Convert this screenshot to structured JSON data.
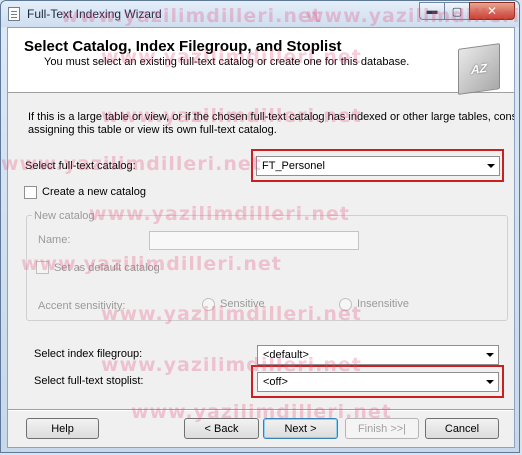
{
  "window": {
    "title": "Full-Text Indexing Wizard",
    "min": "▬",
    "max": "▢",
    "close": "✕"
  },
  "header": {
    "title": "Select Catalog, Index Filegroup, and Stoplist",
    "subtitle": "You must select an existing full-text catalog or create one for this database.",
    "icon_text": "AZ"
  },
  "description": {
    "line1": "If this is a large table or view, or if the chosen full-text catalog has indexed or other large tables, consider",
    "line2": "assigning this table or view its own full-text catalog."
  },
  "catalog": {
    "label": "Select full-text catalog:",
    "value": "FT_Personel"
  },
  "create_new": {
    "label": "Create a new catalog",
    "checked": false
  },
  "new_catalog": {
    "group_label": "New catalog",
    "name_label": "Name:",
    "name_value": "",
    "default_label": "Set as default catalog",
    "accent_label": "Accent sensitivity:",
    "sensitive_label": "Sensitive",
    "insensitive_label": "Insensitive"
  },
  "filegroup": {
    "label": "Select index filegroup:",
    "value": "<default>"
  },
  "stoplist": {
    "label": "Select full-text stoplist:",
    "value": "<off>"
  },
  "buttons": {
    "help": "Help",
    "back": "< Back",
    "next": "Next >",
    "finish": "Finish >>|",
    "cancel": "Cancel"
  },
  "watermark": "www.yazilimdilleri.net",
  "colors": {
    "highlight": "#cc1f1f",
    "watermark": "#e84b7a"
  }
}
